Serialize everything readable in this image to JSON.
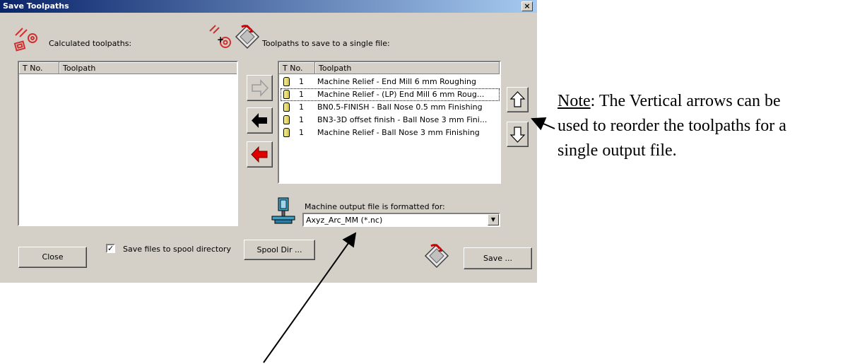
{
  "window": {
    "title": "Save Toolpaths",
    "close_glyph": "×"
  },
  "left_panel": {
    "label": "Calculated toolpaths:",
    "columns": [
      "T No.",
      "Toolpath"
    ]
  },
  "right_panel": {
    "label": "Toolpaths to save to a single file:",
    "columns": [
      "T No.",
      "Toolpath"
    ],
    "rows": [
      {
        "tno": "1",
        "toolpath": "Machine Relief - End Mill 6 mm Roughing"
      },
      {
        "tno": "1",
        "toolpath": "Machine Relief - (LP) End Mill 6 mm Roug..."
      },
      {
        "tno": "1",
        "toolpath": "BN0.5-FINISH - Ball Nose 0.5 mm Finishing"
      },
      {
        "tno": "1",
        "toolpath": "BN3-3D offset finish - Ball Nose 3 mm Fini..."
      },
      {
        "tno": "1",
        "toolpath": "Machine Relief - Ball Nose 3 mm Finishing"
      }
    ]
  },
  "machine_output": {
    "label": "Machine output file is formatted for:",
    "selected": "Axyz_Arc_MM (*.nc)"
  },
  "buttons": {
    "close": "Close",
    "spool_dir": "Spool Dir ...",
    "save": "Save ..."
  },
  "spool_checkbox": {
    "label": "Save files to spool directory",
    "checked": true,
    "mark": "✓"
  },
  "note": {
    "prefix": "Note",
    "line1": ": The Vertical arrows can be",
    "line2": "used to reorder the toolpaths for a",
    "line3": "single output file."
  },
  "colors": {
    "dialog_bg": "#d4d0c8",
    "title_bar_start": "#0a246a",
    "title_bar_end": "#a6caf0",
    "red_arrow": "#e00000",
    "black_arrow": "#000000"
  },
  "icons": [
    "toolpaths-icon",
    "toolpaths-add-icon",
    "save-disk-icon",
    "machine-icon",
    "arrow-right-icon",
    "arrow-left-icon",
    "arrow-left-red-icon",
    "arrow-up-icon",
    "arrow-down-icon"
  ]
}
